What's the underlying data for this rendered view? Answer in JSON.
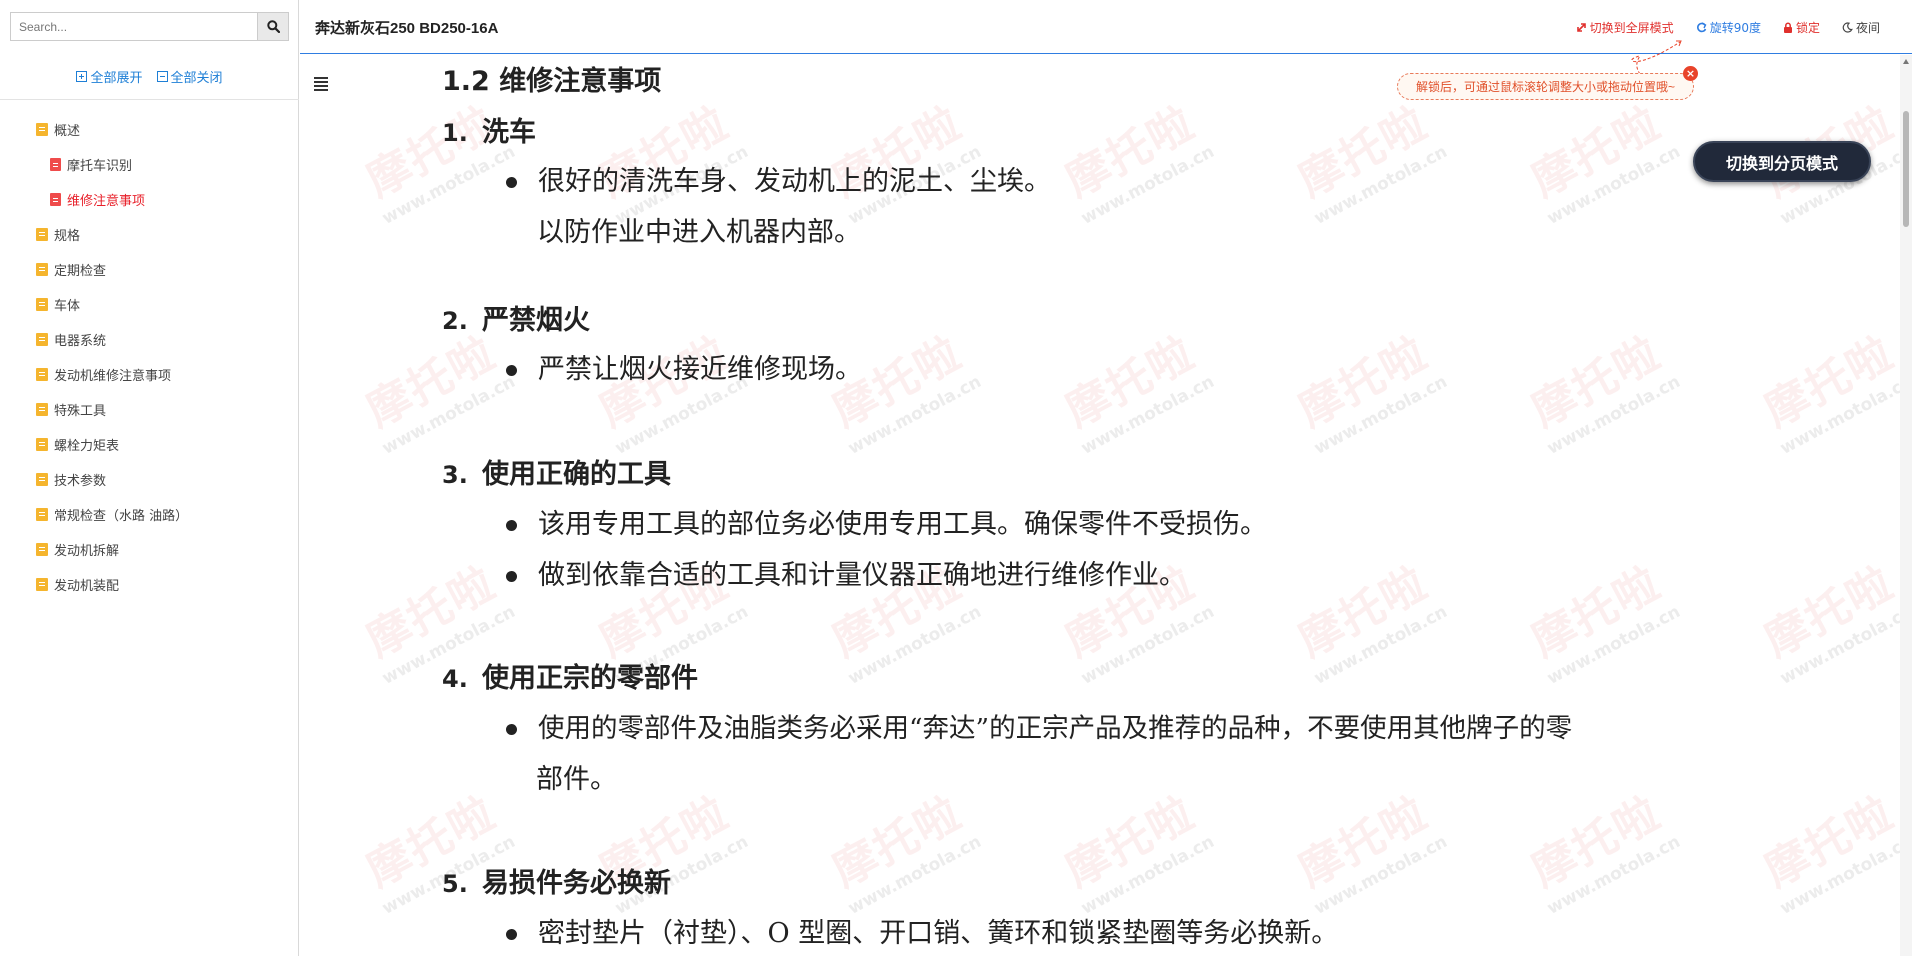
{
  "sidebar": {
    "search_placeholder": "Search...",
    "expand_all": "全部展开",
    "collapse_all": "全部关闭",
    "items": [
      {
        "label": "概述",
        "level": 1,
        "type": "folder",
        "active": false
      },
      {
        "label": "摩托车识别",
        "level": 2,
        "type": "doc",
        "active": false
      },
      {
        "label": "维修注意事项",
        "level": 2,
        "type": "doc",
        "active": true
      },
      {
        "label": "规格",
        "level": 1,
        "type": "folder",
        "active": false
      },
      {
        "label": "定期检查",
        "level": 1,
        "type": "folder",
        "active": false
      },
      {
        "label": "车体",
        "level": 1,
        "type": "folder",
        "active": false
      },
      {
        "label": "电器系统",
        "level": 1,
        "type": "folder",
        "active": false
      },
      {
        "label": "发动机维修注意事项",
        "level": 1,
        "type": "folder",
        "active": false
      },
      {
        "label": "特殊工具",
        "level": 1,
        "type": "folder",
        "active": false
      },
      {
        "label": "螺栓力矩表",
        "level": 1,
        "type": "folder",
        "active": false
      },
      {
        "label": "技术参数",
        "level": 1,
        "type": "folder",
        "active": false
      },
      {
        "label": "常规检查（水路 油路）",
        "level": 1,
        "type": "folder",
        "active": false
      },
      {
        "label": "发动机拆解",
        "level": 1,
        "type": "folder",
        "active": false
      },
      {
        "label": "发动机装配",
        "level": 1,
        "type": "folder",
        "active": false
      }
    ]
  },
  "topbar": {
    "title": "奔达新灰石250 BD250-16A",
    "fullscreen": "切换到全屏模式",
    "rotate": "旋转90度",
    "lock": "锁定",
    "night": "夜间"
  },
  "tip": {
    "text": "解锁后，可通过鼠标滚轮调整大小或拖动位置哦~",
    "close": "×"
  },
  "mode_button": "切换到分页模式",
  "watermark": {
    "big": "摩托啦",
    "small": "www.motola.cn"
  },
  "document": {
    "section_title": "1.2 维修注意事项",
    "headings": [
      {
        "num": "1.",
        "text": "洗车"
      },
      {
        "num": "2.",
        "text": "严禁烟火"
      },
      {
        "num": "3.",
        "text": "使用正确的工具"
      },
      {
        "num": "4.",
        "text": "使用正宗的零部件"
      },
      {
        "num": "5.",
        "text": "易损件务必换新"
      }
    ],
    "lines": [
      "很好的清洗车身、发动机上的泥土、尘埃。",
      "以防作业中进入机器内部。",
      "严禁让烟火接近维修现场。",
      "该用专用工具的部位务必使用专用工具。确保零件不受损伤。",
      "做到依靠合适的工具和计量仪器正确地进行维修作业。",
      "使用的零部件及油脂类务必采用“奔达”的正宗产品及推荐的品种，不要使用其他牌子的零",
      "部件。",
      "密封垫片（衬垫）、O 型圈、开口销、簧环和锁紧垫圈等务必换新。"
    ]
  }
}
